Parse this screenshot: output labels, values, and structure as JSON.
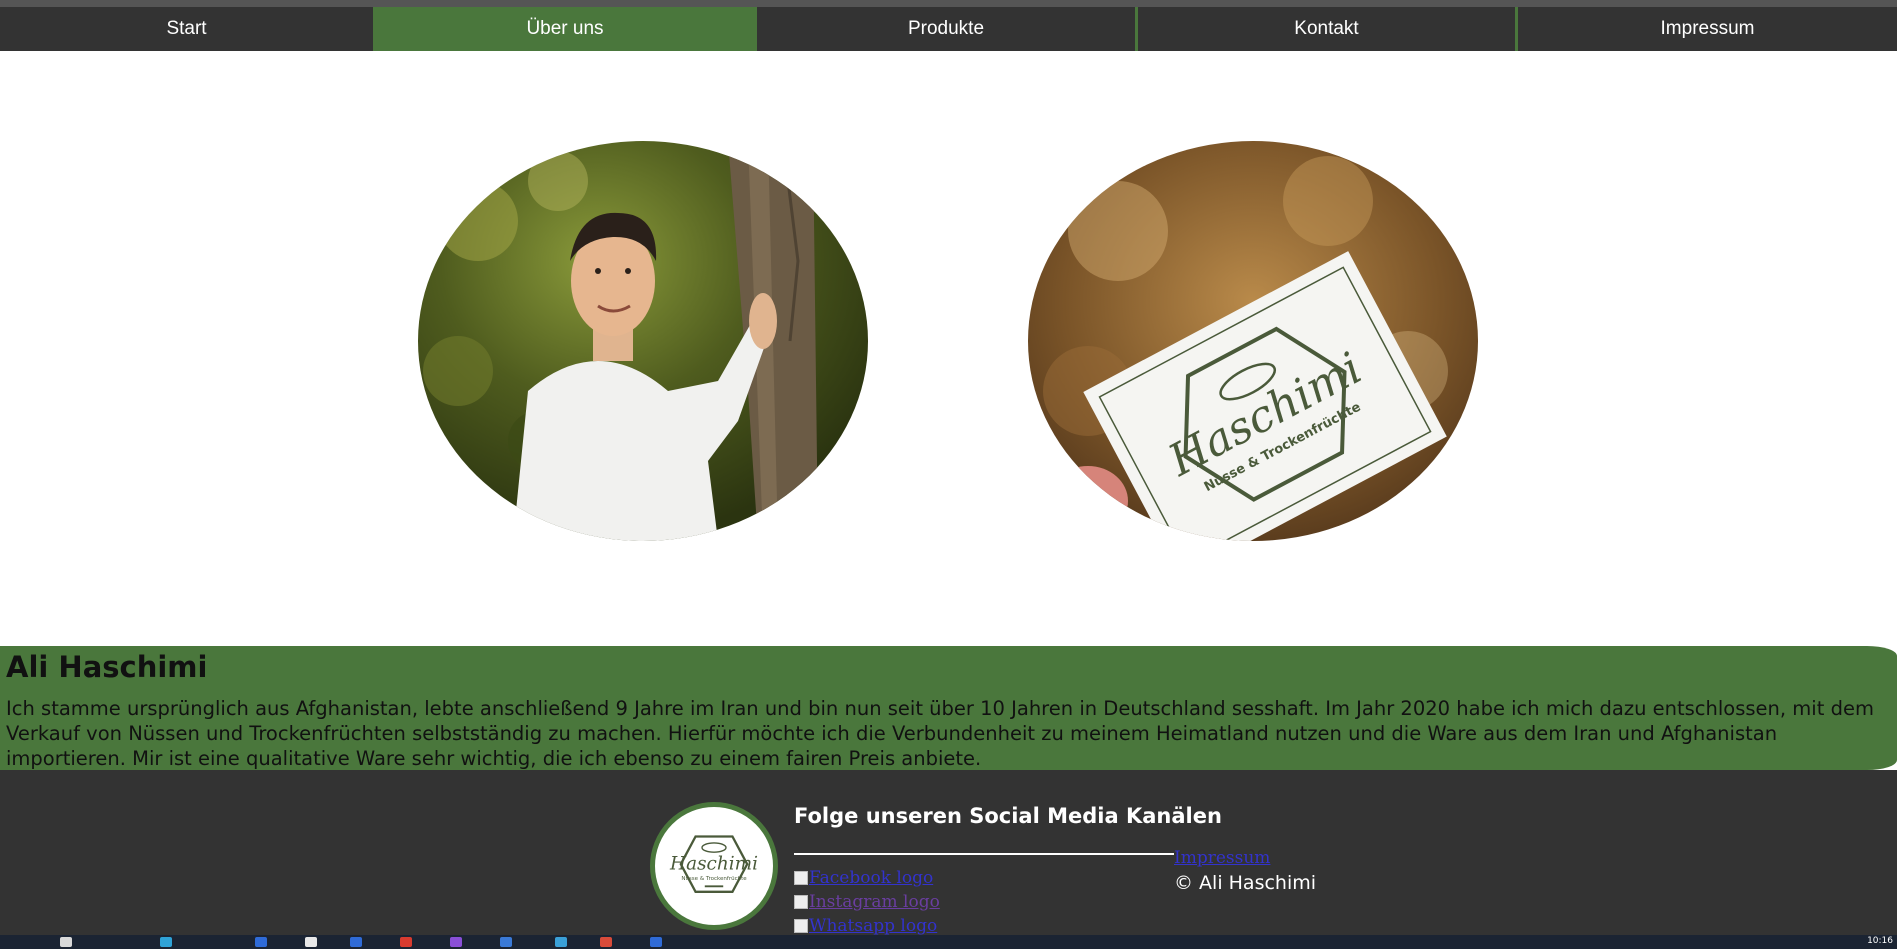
{
  "nav": {
    "items": [
      {
        "label": "Start"
      },
      {
        "label": "Über uns"
      },
      {
        "label": "Produkte"
      },
      {
        "label": "Kontakt"
      },
      {
        "label": "Impressum"
      }
    ],
    "active": "Über uns"
  },
  "photos": {
    "portrait": {
      "icon": "portrait-photo"
    },
    "card": {
      "icon": "business-card-photo",
      "brand": "Haschimi",
      "tagline": "Nüsse & Trockenfrüchte"
    }
  },
  "about": {
    "heading": "Ali Haschimi",
    "text": "Ich stamme ursprünglich aus Afghanistan, lebte anschließend 9 Jahre im Iran und bin nun seit über 10 Jahren in Deutschland sesshaft. Im Jahr 2020 habe ich mich dazu entschlossen, mit dem Verkauf von Nüssen und Trockenfrüchten selbstständig zu machen. Hierfür möchte ich die Verbundenheit zu meinem Heimatland nutzen und die Ware aus dem Iran und Afghanistan importieren. Mir ist eine qualitative Ware sehr wichtig, die ich ebenso zu einem fairen Preis anbiete."
  },
  "footer": {
    "logo": {
      "brand": "Haschimi",
      "tagline": "Nüsse & Trockenfrüchte"
    },
    "social_heading": "Folge unseren Social Media Kanälen",
    "social": {
      "facebook": "Facebook logo",
      "instagram": "Instagram logo",
      "whatsapp": "Whatsapp logo"
    },
    "impressum_link": "Impressum",
    "copyright": "© Ali Haschimi"
  },
  "taskbar": {
    "clock": "10:16"
  },
  "colors": {
    "accent_green": "#4a773c",
    "nav_dark": "#333333",
    "link_blue": "#3333cc"
  }
}
